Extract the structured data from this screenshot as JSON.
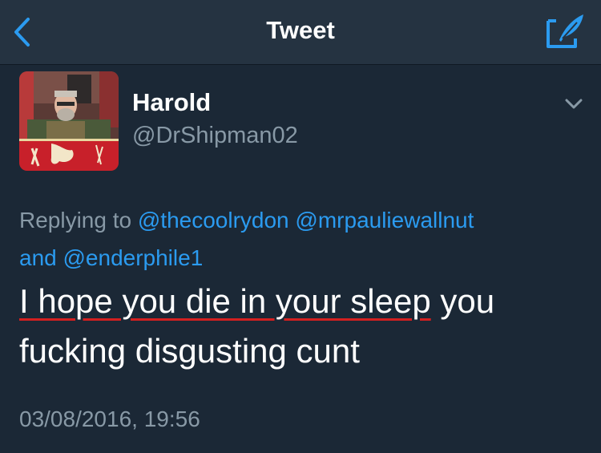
{
  "nav": {
    "title": "Tweet",
    "back_icon": "chevron-left-icon",
    "compose_icon": "compose-tweet-icon"
  },
  "author": {
    "name": "Harold",
    "handle": "@DrShipman02"
  },
  "reply": {
    "prefix": "Replying to",
    "mention_1": "@thecoolrydon",
    "mention_2": "@mrpauliewallnut",
    "conjunction": "and",
    "mention_3": "@enderphile1"
  },
  "tweet": {
    "text_underlined": "I hope you die in your sleep",
    "text_rest": "you fucking disgusting cunt"
  },
  "timestamp": "03/08/2016, 19:56",
  "colors": {
    "background": "#1b2836",
    "nav_background": "#253341",
    "accent": "#2b9bf0",
    "secondary_text": "#8899a6",
    "underline": "#d42020"
  }
}
